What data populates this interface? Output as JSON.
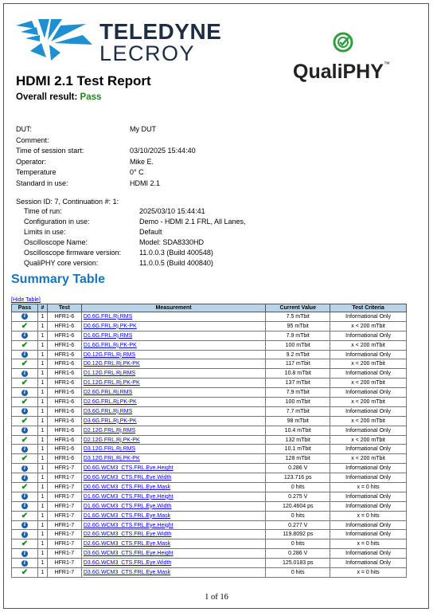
{
  "logos": {
    "teledyne_line1": "TELEDYNE",
    "teledyne_line2": "LECROY",
    "qualiphy_text": "QualiPHY",
    "qualiphy_tm": "™"
  },
  "title": "HDMI 2.1 Test Report",
  "overall": {
    "label": "Overall result:",
    "value": "Pass"
  },
  "session_info": [
    {
      "label": "DUT:",
      "value": "My DUT"
    },
    {
      "label": "Comment:",
      "value": ""
    },
    {
      "label": "Time of session start:",
      "value": "03/10/2025 15:44:40"
    },
    {
      "label": "Operator:",
      "value": "Mike E."
    },
    {
      "label": "Temperature",
      "value": "0° C"
    },
    {
      "label": "Standard in use:",
      "value": "HDMI 2.1"
    }
  ],
  "session_header": "Session ID: 7,  Continuation #: 1:",
  "run_info": [
    {
      "label": "Time of run:",
      "value": "2025/03/10 15:44:41"
    },
    {
      "label": "Configuration in use:",
      "value": "Demo - HDMI 2.1 FRL, All Lanes,"
    },
    {
      "label": "Limits in use:",
      "value": "Default"
    },
    {
      "label": "Oscilloscope Name:",
      "value": "Model: SDA8330HD"
    },
    {
      "label": "Oscilloscope firmware version:",
      "value": "11.0.0.3 (Build 400548)"
    },
    {
      "label": "QualiPHY core version:",
      "value": "11.0.0.5 (Build 400840)"
    }
  ],
  "summary_title": "Summary Table",
  "hide_table_link": "[Hide Table]",
  "table": {
    "headers": [
      "Pass",
      "#",
      "Test",
      "Measurement",
      "Current Value",
      "Test Criteria"
    ],
    "rows": [
      {
        "icon": "info",
        "num": "1",
        "test": "HFR1-6",
        "meas": "D0.6G.FRL.Rj.RMS",
        "value": "7.5 mTbit",
        "crit": "Informational Only"
      },
      {
        "icon": "check",
        "num": "1",
        "test": "HFR1-6",
        "meas": "D0.6G.FRL.Rj.PK-PK",
        "value": "95 mTbit",
        "crit": "x < 200 mTbit"
      },
      {
        "icon": "info",
        "num": "1",
        "test": "HFR1-6",
        "meas": "D1.6G.FRL.Rj.RMS",
        "value": "7.9 mTbit",
        "crit": "Informational Only"
      },
      {
        "icon": "check",
        "num": "1",
        "test": "HFR1-6",
        "meas": "D1.6G.FRL.Rj.PK-PK",
        "value": "100 mTbit",
        "crit": "x < 200 mTbit"
      },
      {
        "icon": "info",
        "num": "1",
        "test": "HFR1-6",
        "meas": "D0.12G.FRL.Rj.RMS",
        "value": "9.2 mTbit",
        "crit": "Informational Only"
      },
      {
        "icon": "check",
        "num": "1",
        "test": "HFR1-6",
        "meas": "D0.12G.FRL.Rj.PK-PK",
        "value": "117 mTbit",
        "crit": "x < 200 mTbit"
      },
      {
        "icon": "info",
        "num": "1",
        "test": "HFR1-6",
        "meas": "D1.12G.FRL.Rj.RMS",
        "value": "10.8 mTbit",
        "crit": "Informational Only"
      },
      {
        "icon": "check",
        "num": "1",
        "test": "HFR1-6",
        "meas": "D1.12G.FRL.Rj.PK-PK",
        "value": "137 mTbit",
        "crit": "x < 200 mTbit"
      },
      {
        "icon": "info",
        "num": "1",
        "test": "HFR1-6",
        "meas": "D2.6G.FRL.Rj.RMS",
        "value": "7.9 mTbit",
        "crit": "Informational Only"
      },
      {
        "icon": "check",
        "num": "1",
        "test": "HFR1-6",
        "meas": "D2.6G.FRL.Rj.PK-PK",
        "value": "100 mTbit",
        "crit": "x < 200 mTbit"
      },
      {
        "icon": "info",
        "num": "1",
        "test": "HFR1-6",
        "meas": "D3.6G.FRL.Rj.RMS",
        "value": "7.7 mTbit",
        "crit": "Informational Only"
      },
      {
        "icon": "check",
        "num": "1",
        "test": "HFR1-6",
        "meas": "D3.6G.FRL.Rj.PK-PK",
        "value": "98 mTbit",
        "crit": "x < 200 mTbit"
      },
      {
        "icon": "info",
        "num": "1",
        "test": "HFR1-6",
        "meas": "D2.12G.FRL.Rj.RMS",
        "value": "10.4 mTbit",
        "crit": "Informational Only"
      },
      {
        "icon": "check",
        "num": "1",
        "test": "HFR1-6",
        "meas": "D2.12G.FRL.Rj.PK-PK",
        "value": "132 mTbit",
        "crit": "x < 200 mTbit"
      },
      {
        "icon": "info",
        "num": "1",
        "test": "HFR1-6",
        "meas": "D3.12G.FRL.Rj.RMS",
        "value": "10.1 mTbit",
        "crit": "Informational Only"
      },
      {
        "icon": "check",
        "num": "1",
        "test": "HFR1-6",
        "meas": "D3.12G.FRL.Rj.PK-PK",
        "value": "128 mTbit",
        "crit": "x < 200 mTbit"
      },
      {
        "icon": "info",
        "num": "1",
        "test": "HFR1-7",
        "meas": "D0.6G.WCM3_CTS.FRL.Eye.Height",
        "value": "0.286 V",
        "crit": "Informational Only"
      },
      {
        "icon": "info",
        "num": "1",
        "test": "HFR1-7",
        "meas": "D0.6G.WCM3_CTS.FRL.Eye.Width",
        "value": "123.716 ps",
        "crit": "Informational Only"
      },
      {
        "icon": "check",
        "num": "1",
        "test": "HFR1-7",
        "meas": "D0.6G.WCM3_CTS.FRL.Eye.Mask",
        "value": "0 hits",
        "crit": "x = 0 hits"
      },
      {
        "icon": "info",
        "num": "1",
        "test": "HFR1-7",
        "meas": "D1.6G.WCM3_CTS.FRL.Eye.Height",
        "value": "0.275 V",
        "crit": "Informational Only"
      },
      {
        "icon": "info",
        "num": "1",
        "test": "HFR1-7",
        "meas": "D1.6G.WCM3_CTS.FRL.Eye.Width",
        "value": "120.4604 ps",
        "crit": "Informational Only"
      },
      {
        "icon": "check",
        "num": "1",
        "test": "HFR1-7",
        "meas": "D1.6G.WCM3_CTS.FRL.Eye.Mask",
        "value": "0 hits",
        "crit": "x = 0 hits"
      },
      {
        "icon": "info",
        "num": "1",
        "test": "HFR1-7",
        "meas": "D2.6G.WCM3_CTS.FRL.Eye.Height",
        "value": "0.277 V",
        "crit": "Informational Only"
      },
      {
        "icon": "info",
        "num": "1",
        "test": "HFR1-7",
        "meas": "D2.6G.WCM3_CTS.FRL.Eye.Width",
        "value": "119.8092 ps",
        "crit": "Informational Only"
      },
      {
        "icon": "check",
        "num": "1",
        "test": "HFR1-7",
        "meas": "D2.6G.WCM3_CTS.FRL.Eye.Mask",
        "value": "0 hits",
        "crit": "x = 0 hits"
      },
      {
        "icon": "info",
        "num": "1",
        "test": "HFR1-7",
        "meas": "D3.6G.WCM3_CTS.FRL.Eye.Height",
        "value": "0.286 V",
        "crit": "Informational Only"
      },
      {
        "icon": "info",
        "num": "1",
        "test": "HFR1-7",
        "meas": "D3.6G.WCM3_CTS.FRL.Eye.Width",
        "value": "125.0183 ps",
        "crit": "Informational Only"
      },
      {
        "icon": "check",
        "num": "1",
        "test": "HFR1-7",
        "meas": "D3.6G.WCM3_CTS.FRL.Eye.Mask",
        "value": "0 hits",
        "crit": "x = 0 hits"
      }
    ]
  },
  "footer": "1 of 16",
  "colors": {
    "pass_green": "#1a8a1a",
    "title_blue": "#1b75bb",
    "header_bg": "#b8d4ea",
    "info_blue": "#1d5ea8",
    "link": "#0000ee"
  }
}
